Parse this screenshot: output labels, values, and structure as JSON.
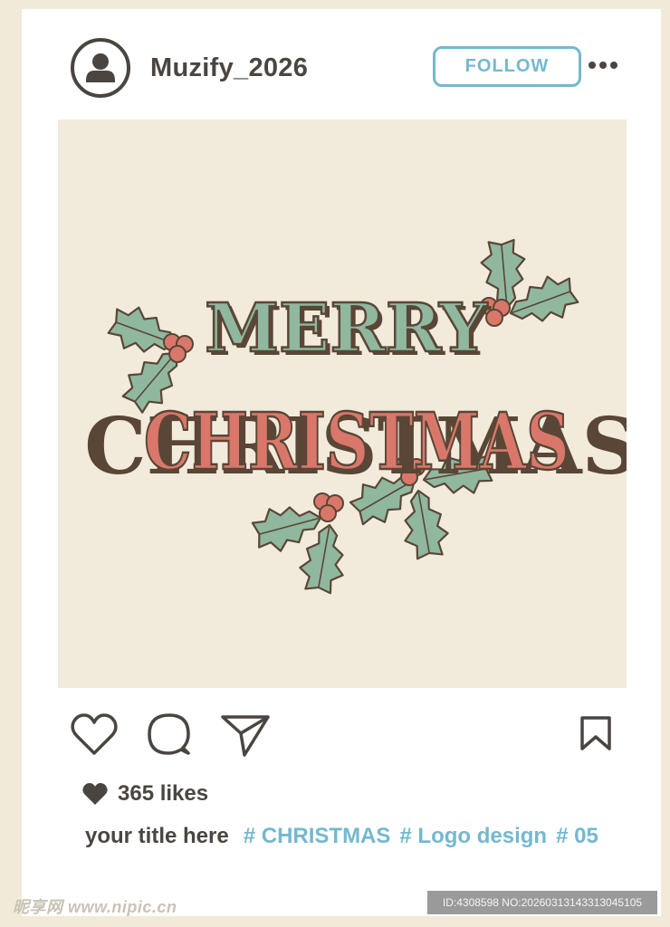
{
  "post": {
    "username": "Muzify_2026",
    "follow_label": "FOLLOW",
    "artwork": {
      "line1": "MERRY",
      "line2": "CHRISTMAS"
    },
    "likes": "365 likes",
    "caption": {
      "title": "your title here",
      "hashtags": [
        "# CHRISTMAS",
        "# Logo design",
        "# 05"
      ]
    }
  },
  "watermark": {
    "site": "昵享网 www.nipic.cn",
    "id_text": "ID:4308598 NO:20260313143313045105"
  },
  "icons": {
    "avatar": "user-avatar-icon",
    "more": "more-options-icon",
    "like": "heart-icon",
    "comment": "comment-icon",
    "share": "send-icon",
    "save": "bookmark-icon"
  },
  "colors": {
    "text_dark": "#4a4540",
    "accent_blue": "#74b8cf",
    "page_bg": "#f1ead8",
    "image_bg": "#f2ebdc",
    "holly_green": "#8fb89f",
    "berry_red": "#d9786a",
    "outline_brown": "#5a4636"
  }
}
